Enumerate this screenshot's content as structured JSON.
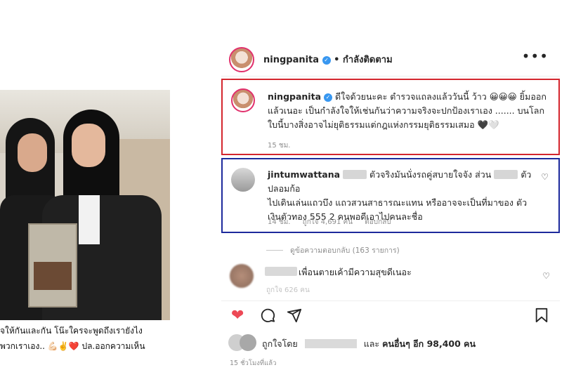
{
  "post": {
    "username": "ningpanita",
    "follow_status": "• กำลังติดตาม",
    "more": "•••",
    "caption_line1": "ดีใจด้วยนะคะ ตำรวจแถลงแล้ววันนี้ ว้าว 😀😀😀 ยิ้มออก",
    "caption_line2": "แล้วเนอะ เป็นกำลังใจให้เช่นกันว่าความจริงจะปกป้องเราเอง ....... บนโลก",
    "caption_line3": "ใบนี้บางสิ่งอาจไม่ยุติธรรมแต่กฎแห่งกรรมยุติธรรมเสมอ 🖤🤍",
    "time": "15 ชม."
  },
  "comment1": {
    "username": "jintumwattana",
    "line1": "ตัวจริงมันนั่งรถคู่สบายใจจัง ส่วน",
    "line1b": "ตัวปลอมก้อ",
    "line2": "ไปเดินเล่นแถวบึง แถวสวนสาธารณะแทน หรืออาจจะเป็นที่มาของ ตัว",
    "line3": "เงินตัวทอง 555 2 คนพอดีเอาไปคนละชื่อ",
    "time": "14 ชม.",
    "likes": "ถูกใจ 4,691 คน",
    "reply": "ตอบกลับ"
  },
  "view_replies": "ดูข้อความตอบกลับ (163 รายการ)",
  "comment2": {
    "text": "เพื่อนตายเค้ามีความสุขดีเนอะ",
    "meta": "ถูกใจ 626 คน"
  },
  "likes": {
    "prefix": "ถูกใจโดย",
    "middle": "และ",
    "others": "คนอื่นๆ อีก 98,400 คน"
  },
  "posted_ago": "15 ชั่วโมงที่แล้ว",
  "left_caption": {
    "line1": "จให้กันและกัน โน๊ะใครจะพูดถึงเรายังไง",
    "line2": "พวกเราเอง.. 💪🏻✌️❤️ ปล.ออกความเห็น"
  },
  "icons": {
    "like": "heart-icon",
    "comment": "comment-bubble-icon",
    "share": "paper-plane-icon",
    "save": "bookmark-icon"
  },
  "colors": {
    "red_highlight": "#d4262e",
    "blue_highlight": "#1d2a9c",
    "like_red": "#ed4956",
    "verified_blue": "#3897f0"
  }
}
